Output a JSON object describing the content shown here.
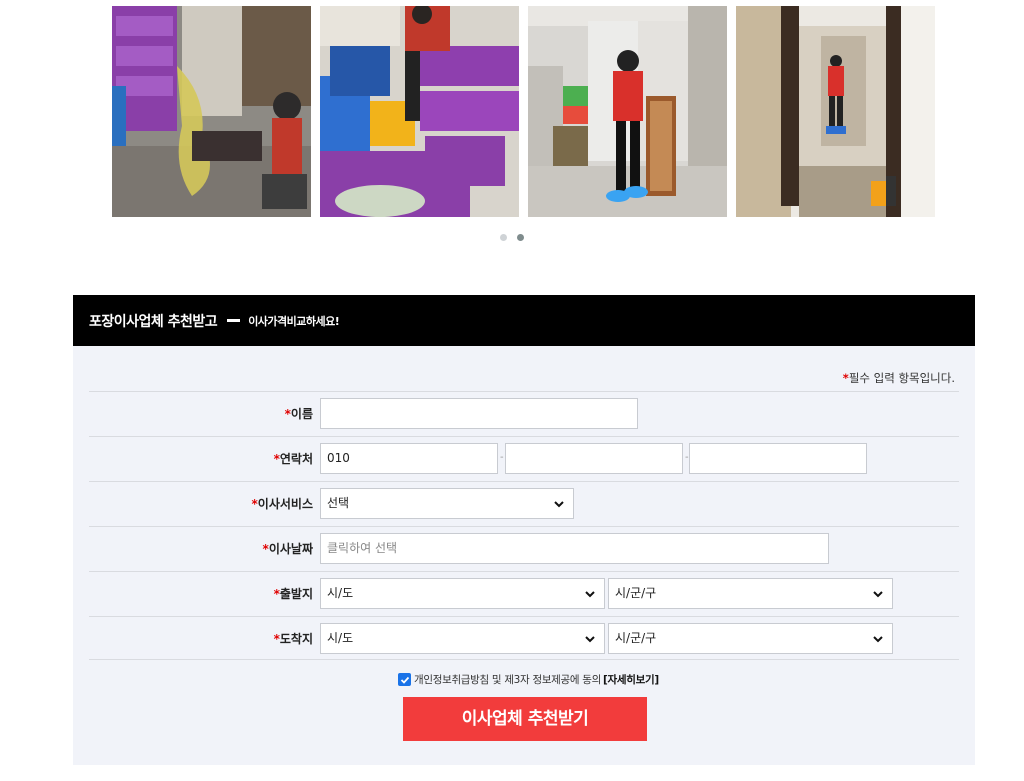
{
  "gallery": {
    "photos": [
      {
        "icon": "photo-cleaning-chair"
      },
      {
        "icon": "photo-purple-crates"
      },
      {
        "icon": "photo-wiping-cabinet"
      },
      {
        "icon": "photo-vacuum-hallway"
      }
    ],
    "dots": 2,
    "active_dot": 2
  },
  "form": {
    "title": "포장이사업체 추천받고",
    "subtitle": "이사가격비교하세요!",
    "required_star": "*",
    "required_note": "필수 입력 항목입니다.",
    "fields": {
      "name": {
        "label": "이름",
        "value": ""
      },
      "phone": {
        "label": "연락처",
        "part1": "010",
        "part2": "",
        "part3": "",
        "separator": "-"
      },
      "service": {
        "label": "이사서비스",
        "selected": "선택"
      },
      "date": {
        "label": "이사날짜",
        "placeholder": "클릭하여 선택"
      },
      "origin": {
        "label": "출발지",
        "sido": "시/도",
        "sigungu": "시/군/구"
      },
      "destination": {
        "label": "도착지",
        "sido": "시/도",
        "sigungu": "시/군/구"
      }
    },
    "agree": {
      "checked": true,
      "text": "개인정보취급방침 및 제3자 정보제공에 동의",
      "more": "[자세히보기]"
    },
    "submit_label": "이사업체 추천받기"
  },
  "colors": {
    "accent": "#f23c3c",
    "required": "#e00000",
    "checkbox": "#1a73e8",
    "header": "#000000",
    "panel": "#f1f3f9"
  }
}
